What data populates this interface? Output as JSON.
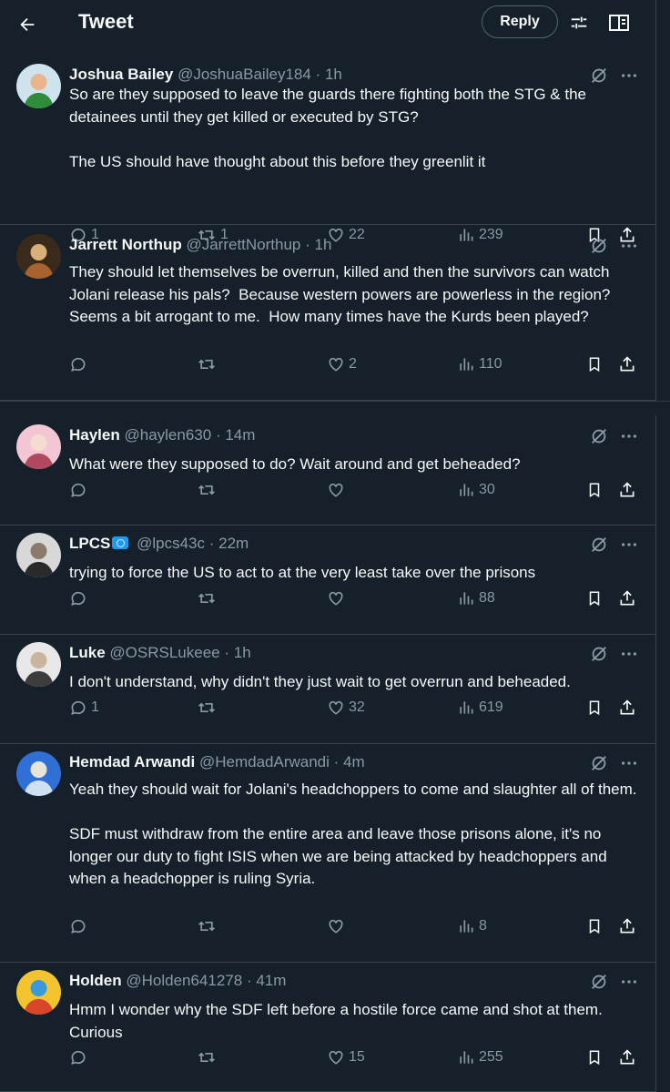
{
  "header": {
    "title": "Tweet",
    "reply_label": "Reply"
  },
  "tweets": [
    {
      "name": "Joshua Bailey",
      "handle": "@JoshuaBailey184",
      "time": "1h",
      "text": "So are they supposed to leave the guards there fighting both the STG & the detainees until they get killed or executed by STG?\n\nThe US should have thought about this before they greenlit it",
      "replies": "1",
      "retweets": "1",
      "likes": "22",
      "views": "239",
      "avatar_colors": [
        "#cfe3ee",
        "#2f8c3a",
        "#e9b58c"
      ]
    },
    {
      "name": "Jarrett Northup",
      "handle": "@JarrettNorthup",
      "time": "1h",
      "text": "They should let themselves be overrun, killed and then the survivors can watch Jolani release his pals?  Because western powers are powerless in the region?Seems a bit arrogant to me.  How many times have the Kurds been played?",
      "replies": "",
      "retweets": "",
      "likes": "2",
      "views": "110",
      "avatar_colors": [
        "#3a2a1c",
        "#a8622f",
        "#d9b07a"
      ]
    },
    {
      "name": "Haylen",
      "handle": "@haylen630",
      "time": "14m",
      "text": "What were they supposed to do? Wait around and get beheaded?",
      "replies": "",
      "retweets": "",
      "likes": "",
      "views": "30",
      "avatar_colors": [
        "#f2c6d3",
        "#b0485f",
        "#f4dcd0"
      ]
    },
    {
      "name": "LPCS",
      "handle": "@lpcs43c",
      "time": "22m",
      "text": "trying to force the US to act to at the very least take over the prisons",
      "replies": "",
      "retweets": "",
      "likes": "",
      "views": "88",
      "avatar_colors": [
        "#d8d8d8",
        "#2a2a2a",
        "#8a7a6a"
      ]
    },
    {
      "name": "Luke",
      "handle": "@OSRSLukeee",
      "time": "1h",
      "text": "I don't understand, why didn't they just wait to get overrun and beheaded.",
      "replies": "1",
      "retweets": "",
      "likes": "32",
      "views": "619",
      "avatar_colors": [
        "#e8e8e8",
        "#3c3c3c",
        "#c9b59f"
      ]
    },
    {
      "name": "Hemdad Arwandi",
      "handle": "@HemdadArwandi",
      "time": "4m",
      "text": "Yeah they should wait for Jolani's headchoppers to come and slaughter all of them.\n\nSDF must withdraw from the entire area and leave those prisons alone, it's no longer our duty to fight ISIS when we are being attacked by headchoppers and when a headchopper is ruling Syria.",
      "replies": "",
      "retweets": "",
      "likes": "",
      "views": "8",
      "avatar_colors": [
        "#2f6fd6",
        "#cfe0f0",
        "#e9e4d8"
      ]
    },
    {
      "name": "Holden",
      "handle": "@Holden641278",
      "time": "41m",
      "text": "Hmm I wonder why the SDF left before a hostile force came and shot at them. Curious",
      "replies": "",
      "retweets": "",
      "likes": "15",
      "views": "255",
      "avatar_colors": [
        "#f4c430",
        "#d8452a",
        "#3a9ad9"
      ]
    }
  ],
  "icons": {
    "back": "arrow-left-icon",
    "filter": "sliders-icon",
    "reader": "book-open-icon",
    "grok": "grok-slash-icon",
    "more": "more-dots-icon",
    "reply": "reply-bubble-icon",
    "retweet": "retweet-icon",
    "like": "heart-icon",
    "views": "views-bars-icon",
    "bookmark": "bookmark-icon",
    "share": "share-icon"
  }
}
